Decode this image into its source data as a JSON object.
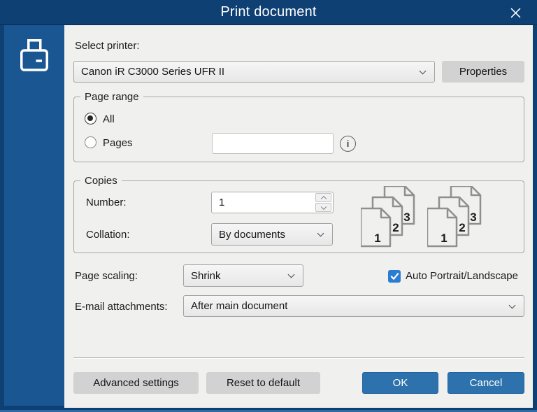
{
  "window": {
    "title": "Print document"
  },
  "printer": {
    "label": "Select printer:",
    "selected": "Canon iR C3000 Series UFR II",
    "properties_button": "Properties"
  },
  "page_range": {
    "legend": "Page range",
    "all_option": "All",
    "all_selected": true,
    "pages_option": "Pages",
    "pages_value": "",
    "info_glyph": "i"
  },
  "copies": {
    "legend": "Copies",
    "number_label": "Number:",
    "number_value": "1",
    "collation_label": "Collation:",
    "collation_value": "By documents",
    "stack_page_numbers": [
      "1",
      "2",
      "3"
    ]
  },
  "page_scaling": {
    "label": "Page scaling:",
    "value": "Shrink"
  },
  "auto_orientation": {
    "label": "Auto Portrait/Landscape",
    "checked": true
  },
  "email_attachments": {
    "label": "E-mail attachments:",
    "value": "After main document"
  },
  "footer": {
    "advanced_button": "Advanced settings",
    "reset_button": "Reset to default",
    "ok_button": "OK",
    "cancel_button": "Cancel"
  },
  "colors": {
    "titlebar": "#0e4074",
    "sidebar": "#1a5792",
    "content_bg": "#f0f0ee",
    "accent_button": "#2e72ad",
    "checkbox": "#2b7cd3"
  }
}
